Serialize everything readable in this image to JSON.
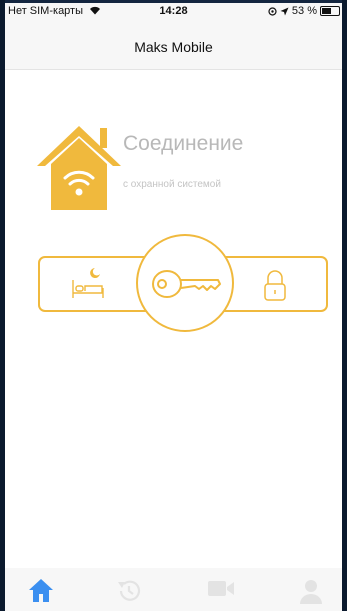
{
  "status_bar": {
    "carrier": "Нет SIM-карты",
    "time": "14:28",
    "battery": "53 %"
  },
  "nav": {
    "title": "Maks Mobile"
  },
  "connection": {
    "title": "Соединение",
    "subtitle": "с охранной системой"
  },
  "modes": {
    "items": [
      "night-mode-icon",
      "key-icon",
      "lock-icon"
    ],
    "selected": "key-icon"
  },
  "tabbar": {
    "tabs": [
      "home-icon",
      "history-icon",
      "video-icon",
      "user-icon"
    ],
    "active": "home-icon"
  },
  "colors": {
    "accent": "#f0b93d",
    "tab_active": "#3b8ff0",
    "tab_inactive": "#e3e3e3"
  }
}
